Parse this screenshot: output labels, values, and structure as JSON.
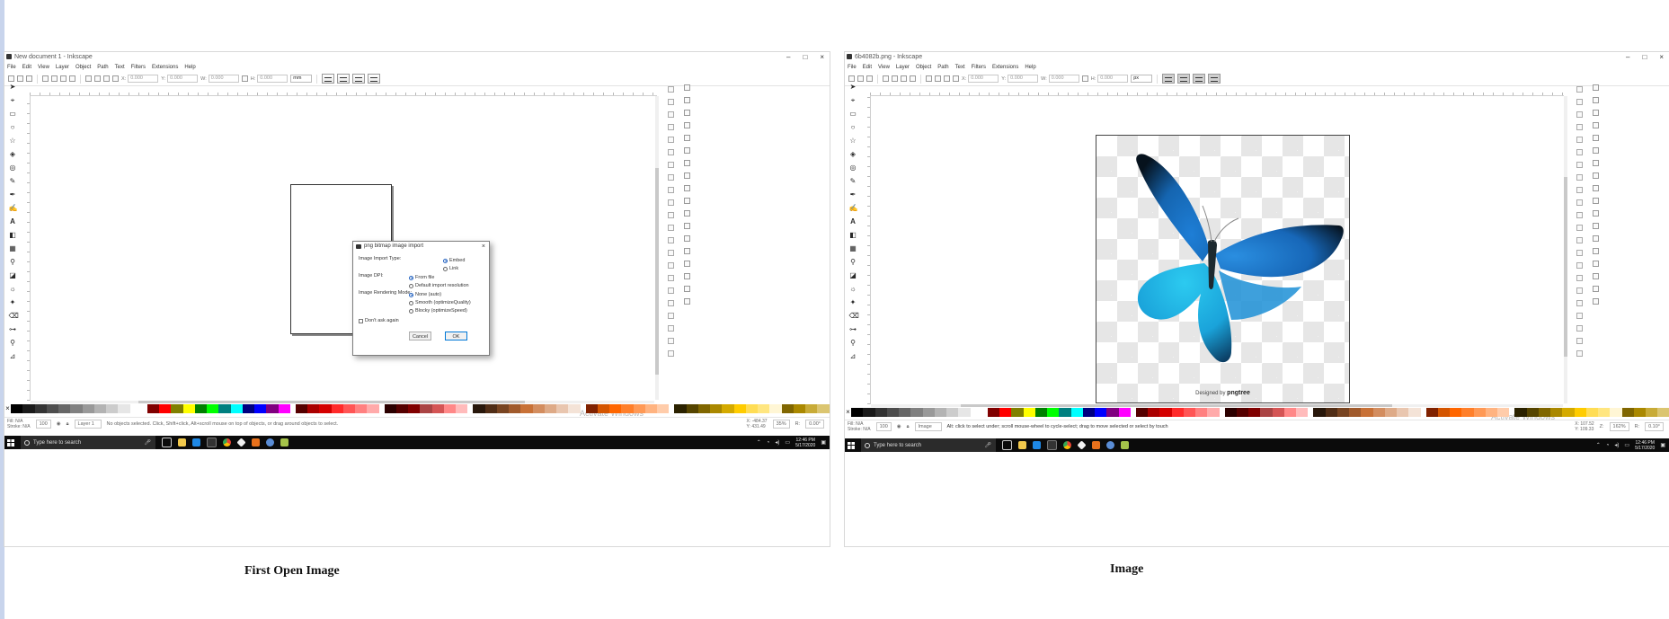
{
  "left_window": {
    "title": "New document 1 - Inkscape",
    "window_controls": [
      "–",
      "□",
      "×"
    ],
    "menu": [
      "File",
      "Edit",
      "View",
      "Layer",
      "Object",
      "Path",
      "Text",
      "Filters",
      "Extensions",
      "Help"
    ],
    "coord_fields": [
      {
        "label": "X:",
        "value": "0.000"
      },
      {
        "label": "Y:",
        "value": "0.000"
      },
      {
        "label": "W:",
        "value": "0.000"
      },
      {
        "label": "H:",
        "value": "0.000"
      }
    ],
    "unit": "mm",
    "watermark": "Activate Windows",
    "dialog": {
      "title": "png bitmap image import",
      "import_type_label": "Image Import Type:",
      "import_type_options": [
        "Embed",
        "Link"
      ],
      "dpi_label": "Image DPI:",
      "dpi_options": [
        "From file",
        "Default import resolution"
      ],
      "rendering_label": "Image Rendering Mode:",
      "rendering_options": [
        "None (auto)",
        "Smooth (optimizeQuality)",
        "Blocky (optimizeSpeed)"
      ],
      "dont_ask": "Don't ask again",
      "cancel": "Cancel",
      "ok": "OK"
    },
    "status": {
      "fill_label": "Fill:",
      "fill_value": "N/A",
      "stroke_label": "Stroke:",
      "stroke_value": "N/A",
      "opacity": "100",
      "layer": "Layer 1",
      "message": "No objects selected. Click, Shift+click, Alt+scroll mouse on top of objects, or drag around objects to select.",
      "x": "X: -484.37",
      "y": "Y: 431.49",
      "zoom": "35%",
      "rotation_label": "R:",
      "rotation": "0.00°"
    },
    "taskbar": {
      "search_placeholder": "Type here to search",
      "time": "12:46 PM",
      "date": "5/17/2020"
    }
  },
  "right_window": {
    "title": "6b4082b.png - Inkscape",
    "window_controls": [
      "–",
      "□",
      "×"
    ],
    "menu": [
      "File",
      "Edit",
      "View",
      "Layer",
      "Object",
      "Path",
      "Text",
      "Filters",
      "Extensions",
      "Help"
    ],
    "coord_fields": [
      {
        "label": "X:",
        "value": "0.000"
      },
      {
        "label": "Y:",
        "value": "0.000"
      },
      {
        "label": "W:",
        "value": "0.000"
      },
      {
        "label": "H:",
        "value": "0.000"
      }
    ],
    "unit": "px",
    "watermark": "Activate Windows",
    "image_credit_prefix": "Designed by",
    "image_credit_brand": "pngtree",
    "status": {
      "fill_label": "Fill:",
      "fill_value": "N/A",
      "stroke_label": "Stroke:",
      "stroke_value": "N/A",
      "opacity": "100",
      "layer": "Image",
      "message": "Alt: click to select under; scroll mouse-wheel to cycle-select; drag to move selected or select by touch",
      "x": "X: 107.52",
      "y": "Y: 109.33",
      "zoom_label": "Z:",
      "zoom": "162%",
      "rotation_label": "R:",
      "rotation": "0.10°"
    },
    "taskbar": {
      "search_placeholder": "Type here to search",
      "time": "12:46 PM",
      "date": "5/17/2020"
    }
  },
  "captions": {
    "left": "First Open  Image",
    "right": "Image"
  },
  "colors": {
    "butterfly_dark": "#06121d",
    "butterfly_blue": "#1e7ed6",
    "butterfly_cyan": "#22b8e8",
    "taskbar": "#0b0b0b",
    "palette": [
      "#000000",
      "#1a1a1a",
      "#333333",
      "#4d4d4d",
      "#666666",
      "#808080",
      "#999999",
      "#b3b3b3",
      "#cccccc",
      "#e6e6e6",
      "#ffffff",
      "#800000",
      "#ff0000",
      "#808000",
      "#ffff00",
      "#008000",
      "#00ff00",
      "#008080",
      "#00ffff",
      "#000080",
      "#0000ff",
      "#800080",
      "#ff00ff",
      "#550000",
      "#aa0000",
      "#d40000",
      "#ff2a2a",
      "#ff5555",
      "#ff8080",
      "#ffaaaa",
      "#2b0000",
      "#550000",
      "#800000",
      "#aa4444",
      "#d45555",
      "#ff8888",
      "#ffbbbb",
      "#28170b",
      "#502d16",
      "#784421",
      "#a05a2c",
      "#c87137",
      "#d38d5f",
      "#deaa87",
      "#e9c6af",
      "#f4e3d7",
      "#802200",
      "#d45500",
      "#ff6600",
      "#ff7f2a",
      "#ff9955",
      "#ffb380",
      "#ffccaa",
      "#2b2200",
      "#554400",
      "#806600",
      "#aa8800",
      "#d4aa00",
      "#ffcc00",
      "#ffdd55",
      "#ffe680",
      "#fff6d5",
      "#806600",
      "#aa8800",
      "#c8ab37",
      "#dbc570"
    ]
  }
}
